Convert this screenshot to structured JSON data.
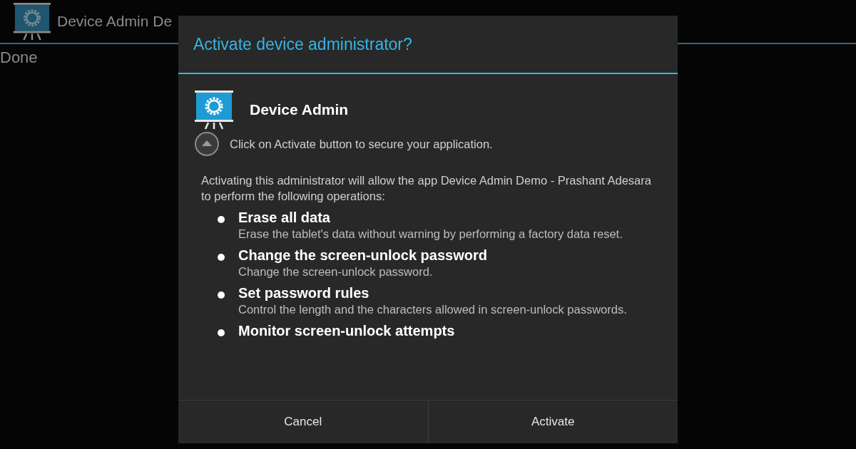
{
  "action_bar": {
    "title": "Device Admin De"
  },
  "background": {
    "done_label": "Done"
  },
  "dialog": {
    "title": "Activate device administrator?",
    "app_name": "Device Admin",
    "description": "Click on Activate button to secure your application.",
    "intro": "Activating this administrator will allow the app Device Admin Demo - Prashant Adesara to perform the following operations:",
    "policies": [
      {
        "title": "Erase all data",
        "detail": "Erase the tablet's data without warning by performing a factory data reset."
      },
      {
        "title": "Change the screen-unlock password",
        "detail": "Change the screen-unlock password."
      },
      {
        "title": "Set password rules",
        "detail": "Control the length and the characters allowed in screen-unlock passwords."
      },
      {
        "title": "Monitor screen-unlock attempts"
      }
    ],
    "buttons": [
      "Cancel",
      "Activate"
    ]
  }
}
